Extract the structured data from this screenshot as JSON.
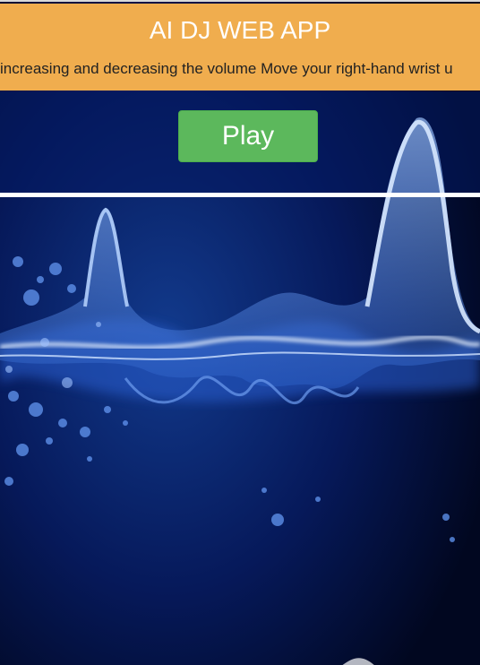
{
  "app": {
    "title": "AI DJ WEB APP",
    "instructions": "increasing and decreasing the volume Move your right-hand wrist u"
  },
  "controls": {
    "play_label": "Play"
  },
  "colors": {
    "header_bg": "#f0ad4e",
    "play_button_bg": "#5cb85c",
    "background": "#020a2a",
    "wave_accent": "#7fb0ff"
  }
}
